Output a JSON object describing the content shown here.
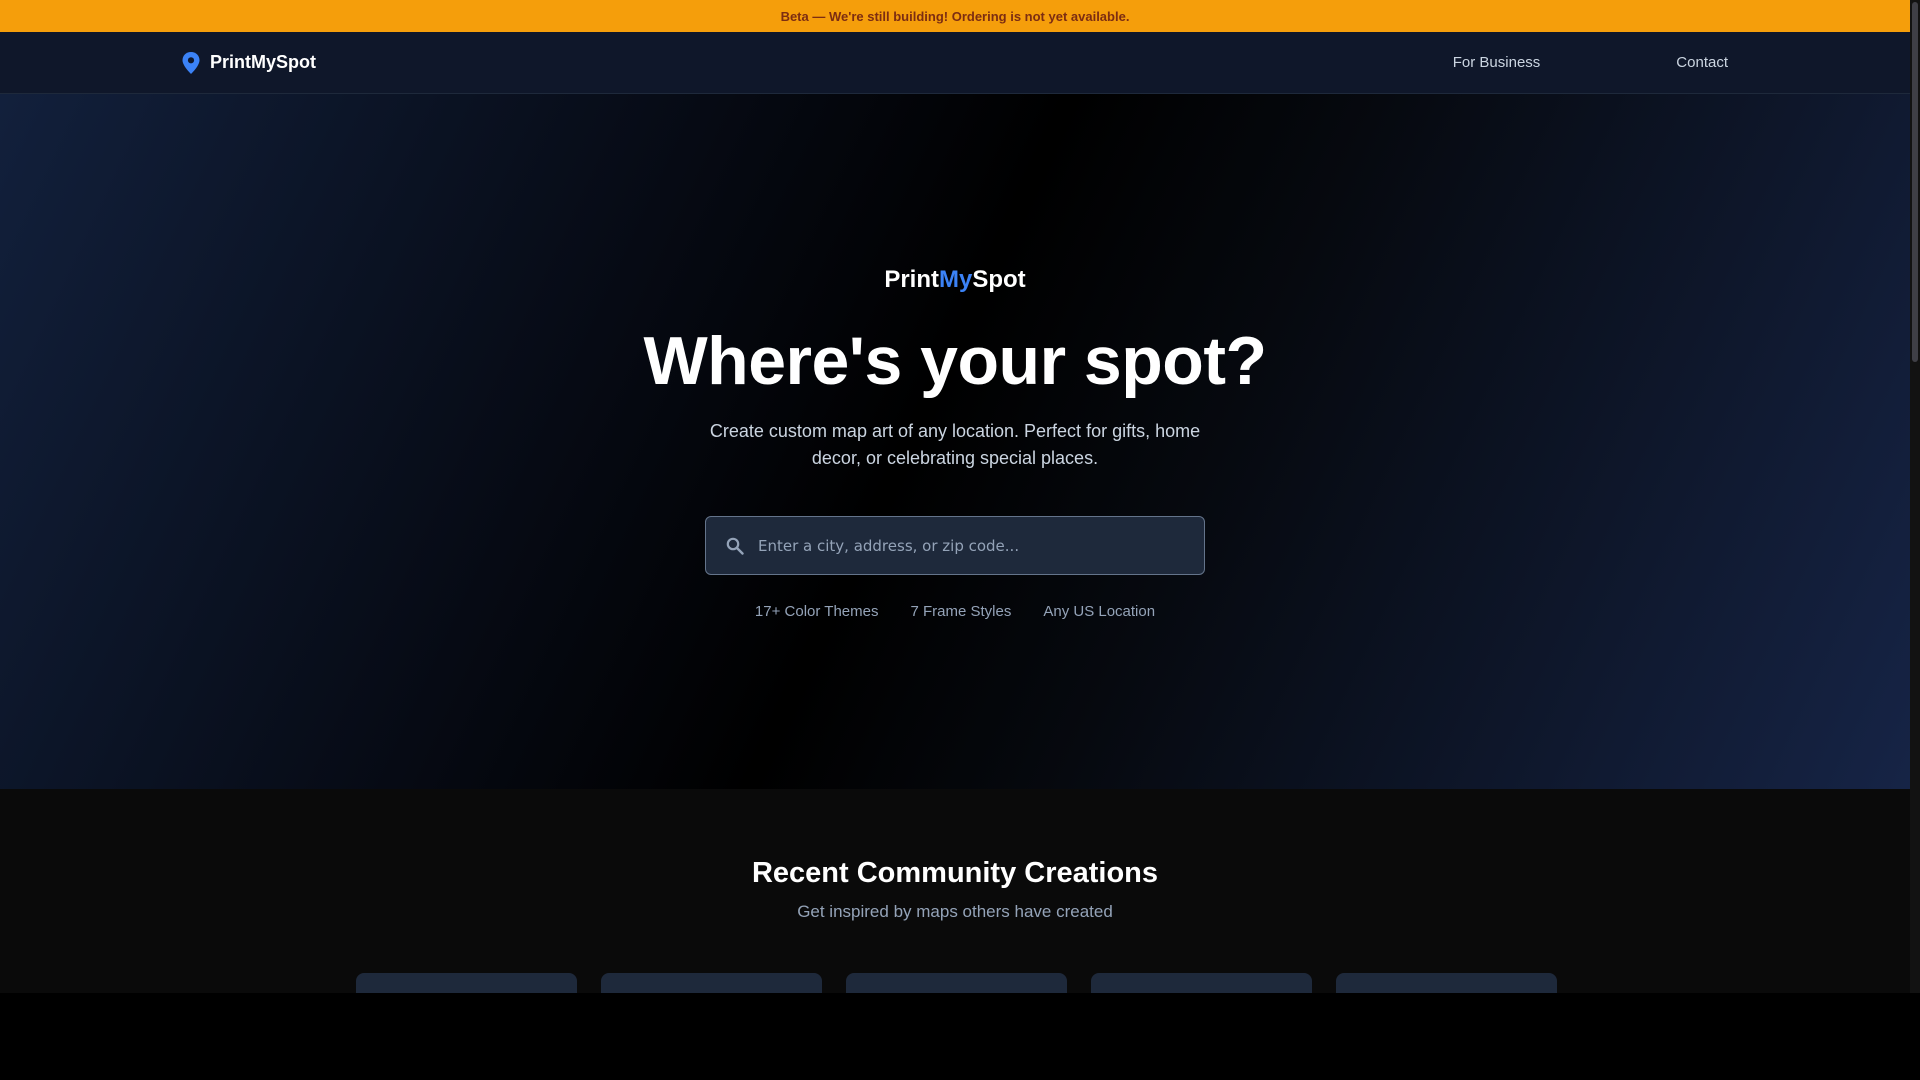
{
  "beta_banner": {
    "text": "Beta — We're still building! Ordering is not yet available."
  },
  "navbar": {
    "brand": "PrintMySpot",
    "links": [
      {
        "label": "For Business"
      },
      {
        "label": "Contact"
      }
    ]
  },
  "hero": {
    "logo": {
      "part1": "Print",
      "part2": "My",
      "part3": "Spot"
    },
    "title": "Where's your spot?",
    "subtitle": "Create custom map art of any location. Perfect for gifts, home decor, or celebrating special places.",
    "search": {
      "placeholder": "Enter a city, address, or zip code...",
      "value": ""
    },
    "features": [
      "17+ Color Themes",
      "7 Frame Styles",
      "Any US Location"
    ]
  },
  "community": {
    "title": "Recent Community Creations",
    "subtitle": "Get inspired by maps others have created",
    "card_count": 5
  },
  "icons": {
    "brand": "map-pin-icon",
    "search": "search-icon"
  },
  "colors": {
    "beta_bg": "#f59e0b",
    "beta_text": "#7c2d12",
    "accent": "#3b82f6",
    "nav_bg": "#0f172a",
    "search_bg": "#1e293b"
  }
}
